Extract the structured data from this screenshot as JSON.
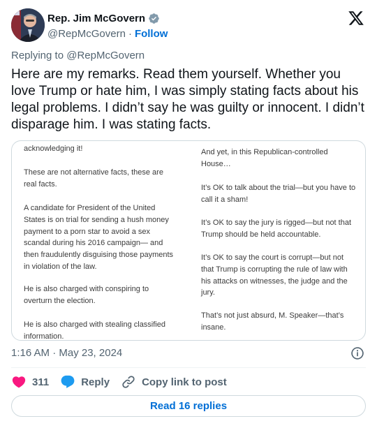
{
  "author": {
    "display_name": "Rep. Jim McGovern",
    "handle": "@RepMcGovern",
    "separator": "·",
    "follow_label": "Follow"
  },
  "replying_to": "Replying to @RepMcGovern",
  "tweet_text": "Here are my remarks. Read them yourself. Whether you love Trump or hate him, I was simply stating facts about his legal problems. I didn’t say he was guilty or innocent. I didn’t disparage him. I was stating facts.",
  "media": {
    "left_column": [
      "acknowledging it!",
      "These are not alternative facts, these are real facts.",
      "A candidate for President of the United States is on trial for sending a hush money payment to a porn star to avoid a sex scandal during his 2016 campaign— and then fraudulently disguising those payments in violation of the law.",
      "He is also charged with conspiring to overturn the election.",
      "He is also charged with stealing classified information."
    ],
    "right_column": [
      "And yet, in this Republican-controlled House…",
      "It’s OK to talk about the trial—but you have to call it a sham!",
      "It’s OK to say the jury is rigged—but not that Trump should be held accountable.",
      "It’s OK to say the court is corrupt—but not that Trump is corrupting the rule of law with his attacks on witnesses, the judge and the jury.",
      "That’s not just absurd, M. Speaker—that’s insane."
    ]
  },
  "timestamp": "1:16 AM · May 23, 2024",
  "actions": {
    "likes_count": "311",
    "reply_label": "Reply",
    "copy_link_label": "Copy link to post"
  },
  "read_replies_label": "Read 16 replies",
  "colors": {
    "link_blue": "#006fd6",
    "heart_red": "#f91880",
    "verified_blue": "#829aab",
    "reply_bubble": "#1d9bf0"
  },
  "icons": [
    "verified-badge-icon",
    "x-logo-icon",
    "info-icon",
    "heart-icon",
    "reply-bubble-icon",
    "link-icon"
  ]
}
